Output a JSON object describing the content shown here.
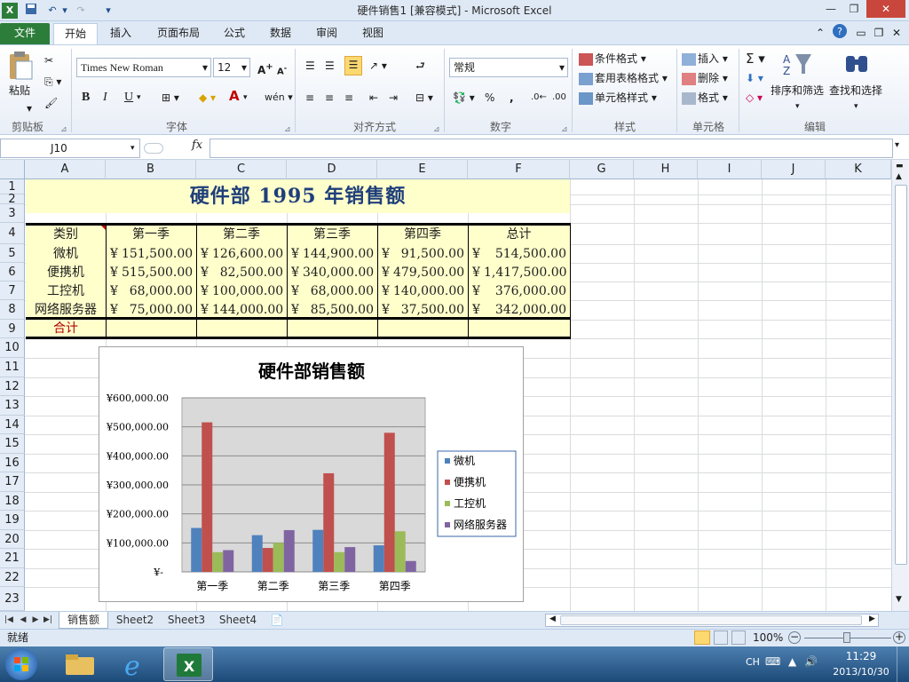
{
  "window": {
    "title": "硬件销售1  [兼容模式] - Microsoft Excel",
    "controls": {
      "minimize": "—",
      "restore": "❐",
      "close": "✕"
    }
  },
  "ribbon": {
    "tabs": [
      "文件",
      "开始",
      "插入",
      "页面布局",
      "公式",
      "数据",
      "审阅",
      "视图"
    ],
    "active_tab": "开始",
    "clipboard": {
      "paste": "粘贴",
      "group": "剪贴板"
    },
    "font": {
      "name": "Times New Roman",
      "size": "12",
      "group": "字体",
      "bold": "B",
      "italic": "I",
      "underline": "U"
    },
    "alignment": {
      "group": "对齐方式"
    },
    "number": {
      "format": "常规",
      "percent": "%",
      "comma": ",",
      "group": "数字"
    },
    "styles": {
      "conditional": "条件格式",
      "table": "套用表格格式",
      "cell": "单元格样式",
      "group": "样式"
    },
    "cells": {
      "insert": "插入",
      "delete": "删除",
      "format": "格式",
      "group": "单元格"
    },
    "editing": {
      "sort": "排序和筛选",
      "find": "查找和选择",
      "group": "编辑"
    }
  },
  "formula_bar": {
    "name_box": "J10",
    "fx": "fx",
    "value": ""
  },
  "columns": [
    "A",
    "B",
    "C",
    "D",
    "E",
    "F",
    "G",
    "H",
    "I",
    "J",
    "K"
  ],
  "rows": [
    "1",
    "2",
    "3",
    "4",
    "5",
    "6",
    "7",
    "8",
    "9",
    "10",
    "11",
    "12",
    "13",
    "14",
    "15",
    "16",
    "17",
    "18",
    "19",
    "20",
    "21",
    "22",
    "23"
  ],
  "sheet": {
    "title": "硬件部  1995  年销售额",
    "header": [
      "类别",
      "第一季",
      "第二季",
      "第三季",
      "第四季",
      "总计"
    ],
    "data": [
      [
        "微机",
        "151,500.00",
        "126,600.00",
        "144,900.00",
        "91,500.00",
        "514,500.00"
      ],
      [
        "便携机",
        "515,500.00",
        "82,500.00",
        "340,000.00",
        "479,500.00",
        "1,417,500.00"
      ],
      [
        "工控机",
        "68,000.00",
        "100,000.00",
        "68,000.00",
        "140,000.00",
        "376,000.00"
      ],
      [
        "网络服务器",
        "75,000.00",
        "144,000.00",
        "85,500.00",
        "37,500.00",
        "342,000.00"
      ]
    ],
    "currency": "¥",
    "total_label": "合计"
  },
  "chart_data": {
    "type": "bar",
    "title": "硬件部销售额",
    "categories": [
      "第一季",
      "第二季",
      "第三季",
      "第四季"
    ],
    "series": [
      {
        "name": "微机",
        "values": [
          151500,
          126600,
          144900,
          91500
        ],
        "color": "#4f81bd"
      },
      {
        "name": "便携机",
        "values": [
          515500,
          82500,
          340000,
          479500
        ],
        "color": "#c0504d"
      },
      {
        "name": "工控机",
        "values": [
          68000,
          100000,
          68000,
          140000
        ],
        "color": "#9bbb59"
      },
      {
        "name": "网络服务器",
        "values": [
          75000,
          144000,
          85500,
          37500
        ],
        "color": "#8064a2"
      }
    ],
    "ylim": [
      0,
      600000
    ],
    "yticks": [
      "¥-",
      "¥100,000.00",
      "¥200,000.00",
      "¥300,000.00",
      "¥400,000.00",
      "¥500,000.00",
      "¥600,000.00"
    ],
    "legend_position": "right",
    "grid": true,
    "plot_background": "#d9d9d9"
  },
  "sheet_tabs": [
    "销售额",
    "Sheet2",
    "Sheet3",
    "Sheet4"
  ],
  "active_sheet": "销售额",
  "status": {
    "ready": "就绪",
    "zoom": "100%"
  },
  "taskbar": {
    "lang": "CH",
    "time": "11:29",
    "date": "2013/10/30"
  }
}
